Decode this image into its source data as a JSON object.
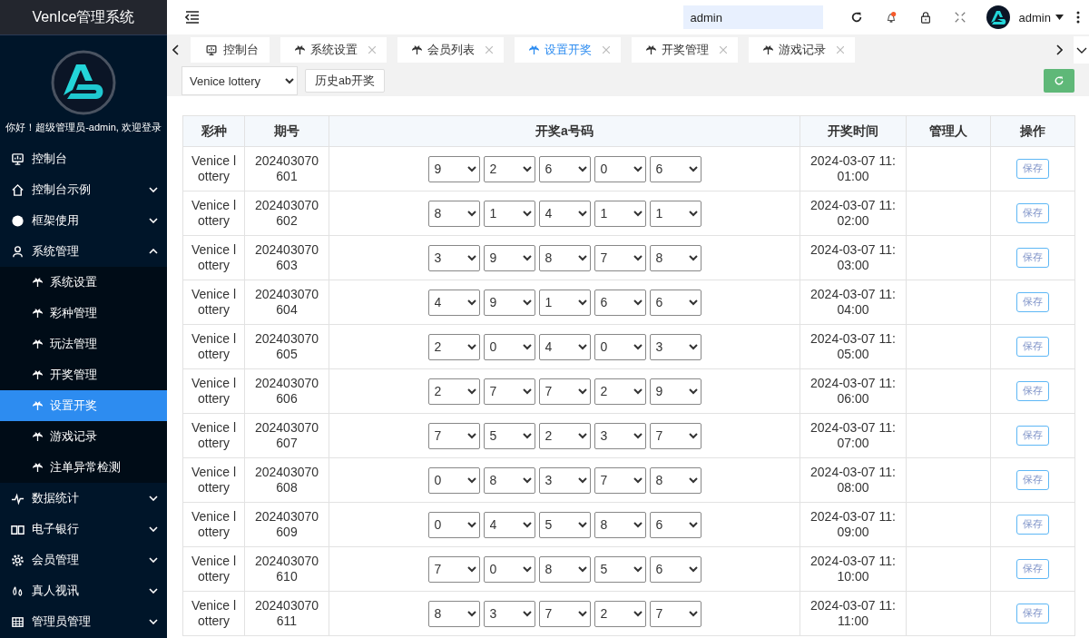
{
  "sidebar": {
    "title": "VenIce管理系统",
    "greeting": "你好！超级管理员-admin, 欢迎登录",
    "items": [
      {
        "label": "控制台",
        "kind": "link"
      },
      {
        "label": "控制台示例",
        "kind": "menu",
        "expanded": false
      },
      {
        "label": "框架使用",
        "kind": "menu",
        "expanded": false
      },
      {
        "label": "系统管理",
        "kind": "menu",
        "expanded": true,
        "children": [
          {
            "label": "系统设置",
            "selected": false
          },
          {
            "label": "彩种管理",
            "selected": false
          },
          {
            "label": "玩法管理",
            "selected": false
          },
          {
            "label": "开奖管理",
            "selected": false
          },
          {
            "label": "设置开奖",
            "selected": true
          },
          {
            "label": "游戏记录",
            "selected": false
          },
          {
            "label": "注单异常检测",
            "selected": false
          }
        ]
      },
      {
        "label": "数据统计",
        "kind": "menu",
        "expanded": false
      },
      {
        "label": "电子银行",
        "kind": "menu",
        "expanded": false
      },
      {
        "label": "会员管理",
        "kind": "menu",
        "expanded": false
      },
      {
        "label": "真人视讯",
        "kind": "menu",
        "expanded": false
      },
      {
        "label": "管理员管理",
        "kind": "menu",
        "expanded": false
      }
    ]
  },
  "header": {
    "search_value": "admin",
    "user": "admin"
  },
  "tabs": [
    {
      "label": "控制台",
      "kind": "home",
      "selected": false
    },
    {
      "label": "系统设置",
      "kind": "page",
      "selected": false
    },
    {
      "label": "会员列表",
      "kind": "page",
      "selected": false
    },
    {
      "label": "设置开奖",
      "kind": "page",
      "selected": true
    },
    {
      "label": "开奖管理",
      "kind": "page",
      "selected": false
    },
    {
      "label": "游戏记录",
      "kind": "page",
      "selected": false
    }
  ],
  "toolbar": {
    "lottery": "Venice lottery",
    "history_button": "历史ab开奖"
  },
  "table": {
    "columns": [
      "彩种",
      "期号",
      "开奖a号码",
      "开奖时间",
      "管理人",
      "操作"
    ],
    "rows": [
      {
        "name": "Venice lottery",
        "period": "202403070601",
        "numbers": [
          "9",
          "2",
          "6",
          "0",
          "6"
        ],
        "time": "2024-03-07 11:01:00",
        "action": "保存"
      },
      {
        "name": "Venice lottery",
        "period": "202403070602",
        "numbers": [
          "8",
          "1",
          "4",
          "1",
          "1"
        ],
        "time": "2024-03-07 11:02:00",
        "action": "保存"
      },
      {
        "name": "Venice lottery",
        "period": "202403070603",
        "numbers": [
          "3",
          "9",
          "8",
          "7",
          "8"
        ],
        "time": "2024-03-07 11:03:00",
        "action": "保存"
      },
      {
        "name": "Venice lottery",
        "period": "202403070604",
        "numbers": [
          "4",
          "9",
          "1",
          "6",
          "6"
        ],
        "time": "2024-03-07 11:04:00",
        "action": "保存"
      },
      {
        "name": "Venice lottery",
        "period": "202403070605",
        "numbers": [
          "2",
          "0",
          "4",
          "0",
          "3"
        ],
        "time": "2024-03-07 11:05:00",
        "action": "保存"
      },
      {
        "name": "Venice lottery",
        "period": "202403070606",
        "numbers": [
          "2",
          "7",
          "7",
          "2",
          "9"
        ],
        "time": "2024-03-07 11:06:00",
        "action": "保存"
      },
      {
        "name": "Venice lottery",
        "period": "202403070607",
        "numbers": [
          "7",
          "5",
          "2",
          "3",
          "7"
        ],
        "time": "2024-03-07 11:07:00",
        "action": "保存"
      },
      {
        "name": "Venice lottery",
        "period": "202403070608",
        "numbers": [
          "0",
          "8",
          "3",
          "7",
          "8"
        ],
        "time": "2024-03-07 11:08:00",
        "action": "保存"
      },
      {
        "name": "Venice lottery",
        "period": "202403070609",
        "numbers": [
          "0",
          "4",
          "5",
          "8",
          "6"
        ],
        "time": "2024-03-07 11:09:00",
        "action": "保存"
      },
      {
        "name": "Venice lottery",
        "period": "202403070610",
        "numbers": [
          "7",
          "0",
          "8",
          "5",
          "6"
        ],
        "time": "2024-03-07 11:10:00",
        "action": "保存"
      },
      {
        "name": "Venice lottery",
        "period": "202403070611",
        "numbers": [
          "8",
          "3",
          "7",
          "2",
          "7"
        ],
        "time": "2024-03-07 11:11:00",
        "action": "保存"
      }
    ]
  }
}
